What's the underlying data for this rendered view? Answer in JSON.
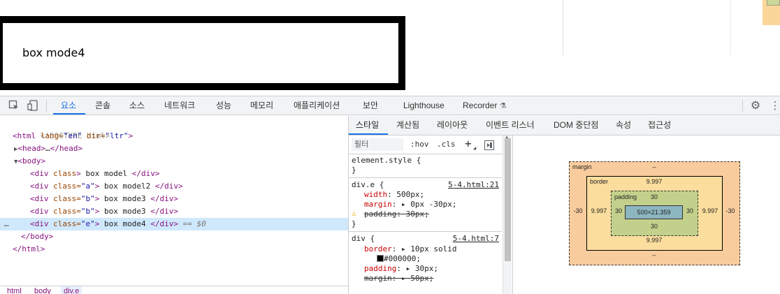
{
  "page": {
    "box_text": "box mode4"
  },
  "toolbar": {
    "tabs": [
      "요소",
      "콘솔",
      "소스",
      "네트워크",
      "성능",
      "메모리",
      "애플리케이션",
      "보안",
      "Lighthouse",
      "Recorder"
    ],
    "active_tab": "요소"
  },
  "dom": {
    "lines": [
      {
        "comment": "<!DOCTYPE html>"
      },
      {
        "open": "<html",
        "a1n": " lang=",
        "a1v": "\"en\"",
        "a2n": " dir=",
        "a2v": "\"ltr\"",
        "close": ">"
      },
      {
        "tag": "<head>",
        "text": "…",
        "end": "</head>"
      },
      {
        "tag": "<body>"
      },
      {
        "open": "<div",
        "a1n": " class",
        "close": ">",
        "text": " box model ",
        "end": "</div>"
      },
      {
        "open": "<div",
        "a1n": " class=",
        "a1v": "\"a\"",
        "close": ">",
        "text": " box model2 ",
        "end": "</div>"
      },
      {
        "open": "<div",
        "a1n": " class=",
        "a1v": "\"b\"",
        "close": ">",
        "text": " box mode3 ",
        "end": "</div>"
      },
      {
        "open": "<div",
        "a1n": " class=",
        "a1v": "\"b\"",
        "close": ">",
        "text": " box mode3 ",
        "end": "</div>"
      },
      {
        "open": "<div",
        "a1n": " class=",
        "a1v": "\"e\"",
        "close": ">",
        "text": " box mode4 ",
        "end": "</div>",
        "sel": " == $0"
      },
      {
        "tag": "</body>"
      },
      {
        "tag": "</html>"
      }
    ],
    "ellipsis": "…",
    "breadcrumbs": [
      "html",
      "body",
      "div.e"
    ]
  },
  "styles": {
    "subtabs": [
      "스타일",
      "계산됨",
      "레이아웃",
      "이벤트 리스너",
      "DOM 중단점",
      "속성",
      "접근성"
    ],
    "active_subtab": "스타일",
    "filter_placeholder": "필터",
    "hov": ":hov",
    "cls": ".cls",
    "plus": "+",
    "element_style": "element.style {",
    "close_brace": "}",
    "rule_e": {
      "selector": "div.e {",
      "source": "5-4.html:21",
      "width_prop": "width",
      "width_val": ": 500px;",
      "margin_prop": "margin",
      "margin_val": ": ▸ 0px -30px;",
      "padding_prop": "padding",
      "padding_val": ": 30px;"
    },
    "rule_div": {
      "selector": "div {",
      "source": "5-4.html:7",
      "border_prop": "border",
      "border_val": ": ▸ 10px solid",
      "border_color": "#000000;",
      "padding_prop": "padding",
      "padding_val": ": ▸ 30px;",
      "margin_prop": "margin",
      "margin_val": ": ▸ 50px;"
    }
  },
  "boxmodel": {
    "margin_label": "margin",
    "margin_top": "–",
    "margin_bottom": "–",
    "margin_left": "-30",
    "margin_right": "-30",
    "border_label": "border",
    "border_top": "9.997",
    "border_bottom": "9.997",
    "border_left": "9.997",
    "border_right": "9.997",
    "padding_label": "padding",
    "padding_top": "30",
    "padding_bottom": "30",
    "padding_left": "30",
    "padding_right": "30",
    "content": "500×21.359"
  }
}
